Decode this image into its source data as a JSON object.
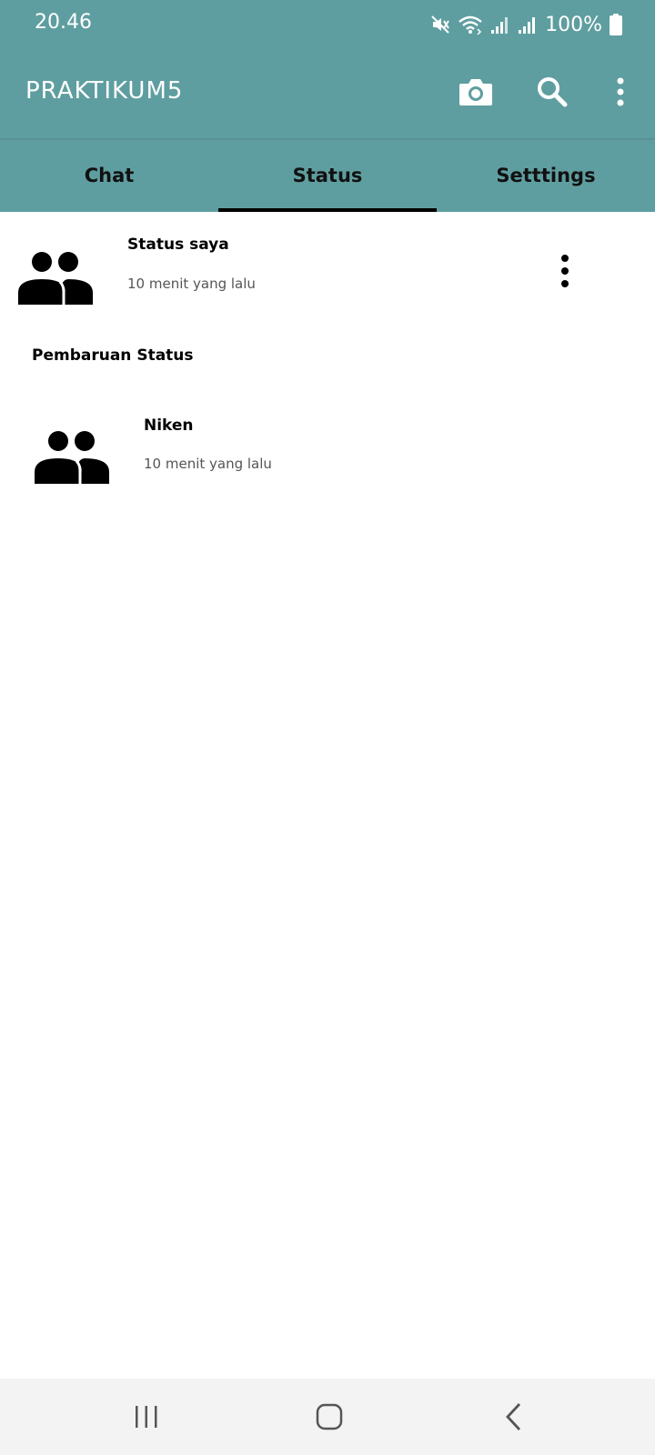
{
  "status_bar": {
    "time": "20.46",
    "battery": "100%",
    "icons": [
      "mute-icon",
      "wifi-icon",
      "signal-icon",
      "signal-icon",
      "battery-icon"
    ]
  },
  "app_bar": {
    "title": "PRAKTIKUM5",
    "background_color": "#5f9ea0",
    "actions": [
      "camera-icon",
      "search-icon",
      "more-vert-icon"
    ]
  },
  "tabs": [
    {
      "label": "Chat",
      "active": false
    },
    {
      "label": "Status",
      "active": true
    },
    {
      "label": "Setttings",
      "active": false
    }
  ],
  "my_status": {
    "name": "Status saya",
    "time": "10 menit yang lalu",
    "icon": "group-icon"
  },
  "updates": {
    "section_title": "Pembaruan Status",
    "items": [
      {
        "name": "Niken",
        "time": "10 menit yang lalu",
        "icon": "group-icon"
      }
    ]
  },
  "nav_bar": {
    "buttons": [
      "recents-icon",
      "home-icon",
      "back-icon"
    ]
  }
}
